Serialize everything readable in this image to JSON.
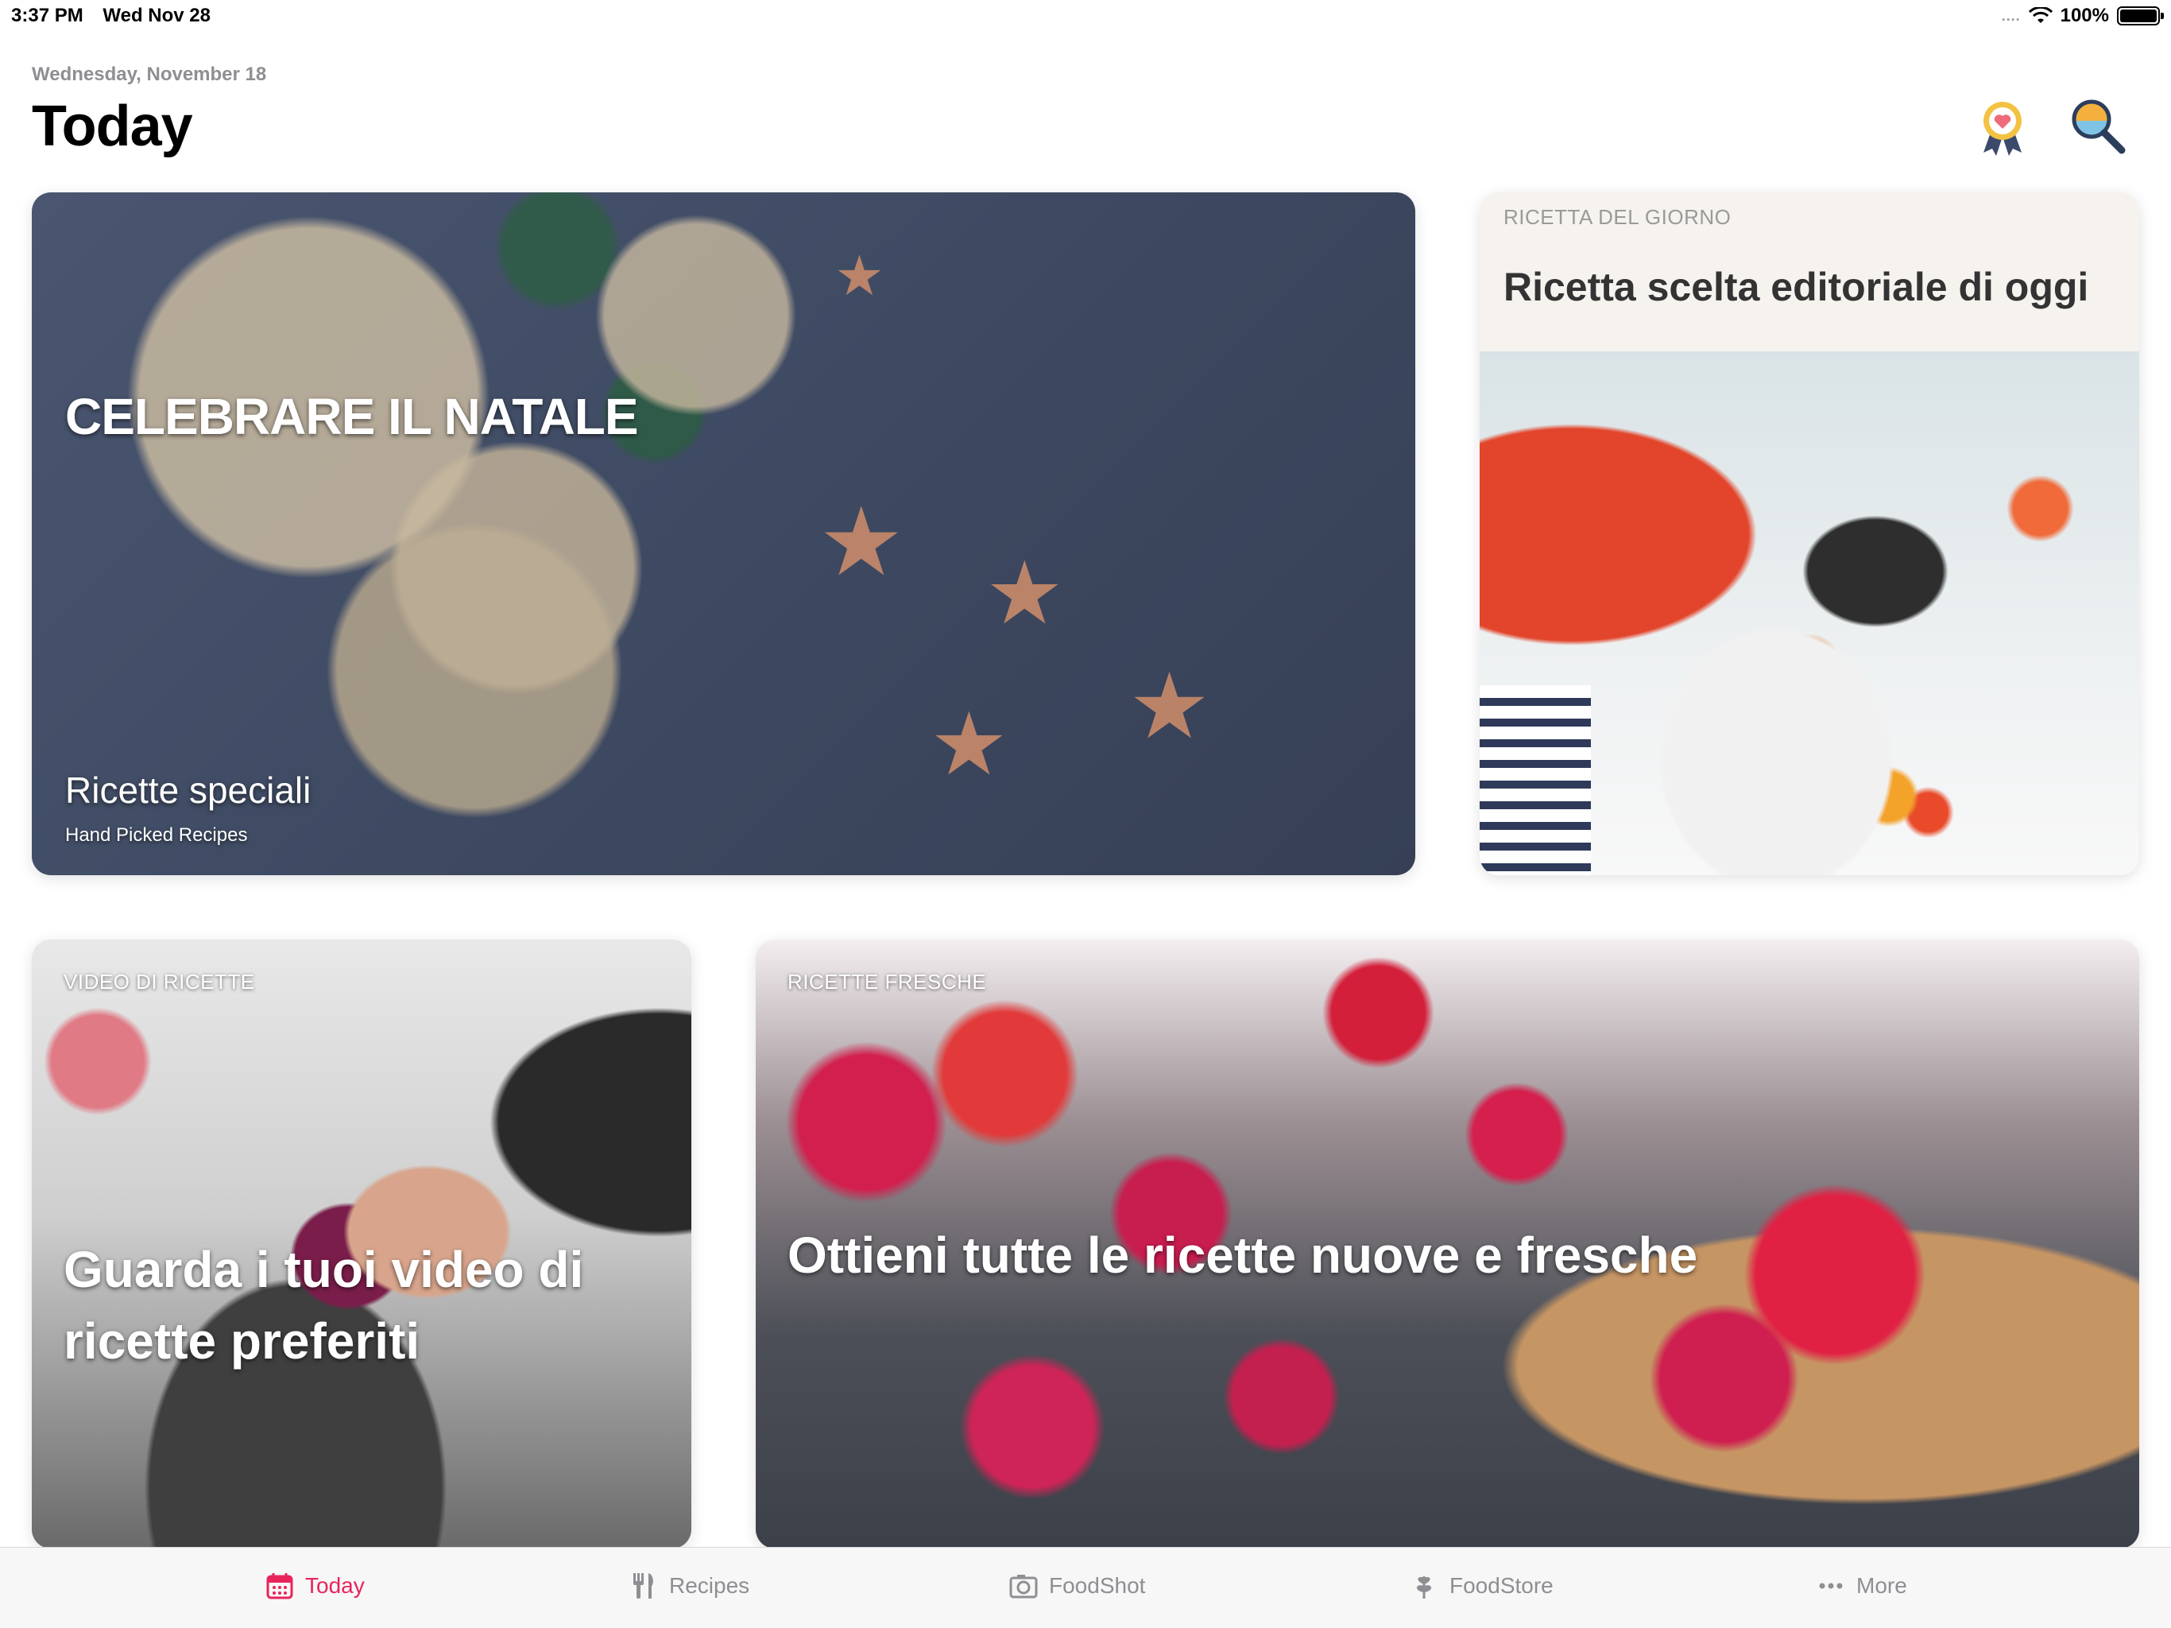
{
  "status_bar": {
    "time": "3:37 PM",
    "date": "Wed Nov 28",
    "signal": "....",
    "battery_percent": "100%",
    "battery_level": 1.0
  },
  "header": {
    "date": "Wednesday, November 18",
    "title": "Today",
    "icons": [
      "award-badge-icon",
      "search-icon"
    ]
  },
  "cards": {
    "christmas": {
      "headline": "CELEBRARE IL NATALE",
      "subtitle": "Ricette speciali",
      "caption": "Hand Picked Recipes"
    },
    "recipe_of_day": {
      "eyebrow": "RICETTA DEL GIORNO",
      "heading": "Ricetta scelta editoriale di oggi"
    },
    "videos": {
      "eyebrow": "VIDEO DI RICETTE",
      "headline": "Guarda i tuoi video di ricette preferiti"
    },
    "fresh": {
      "eyebrow": "RICETTE FRESCHE",
      "headline": "Ottieni tutte le ricette nuove e fresche"
    }
  },
  "tabbar": {
    "items": [
      {
        "label": "Today",
        "icon": "calendar-icon",
        "active": true
      },
      {
        "label": "Recipes",
        "icon": "fork-knife-icon",
        "active": false
      },
      {
        "label": "FoodShot",
        "icon": "camera-icon",
        "active": false
      },
      {
        "label": "FoodStore",
        "icon": "leaf-icon",
        "active": false
      },
      {
        "label": "More",
        "icon": "more-dots-icon",
        "active": false
      }
    ]
  },
  "colors": {
    "accent": "#e8245b",
    "inactive_tab": "#8e8e93"
  }
}
